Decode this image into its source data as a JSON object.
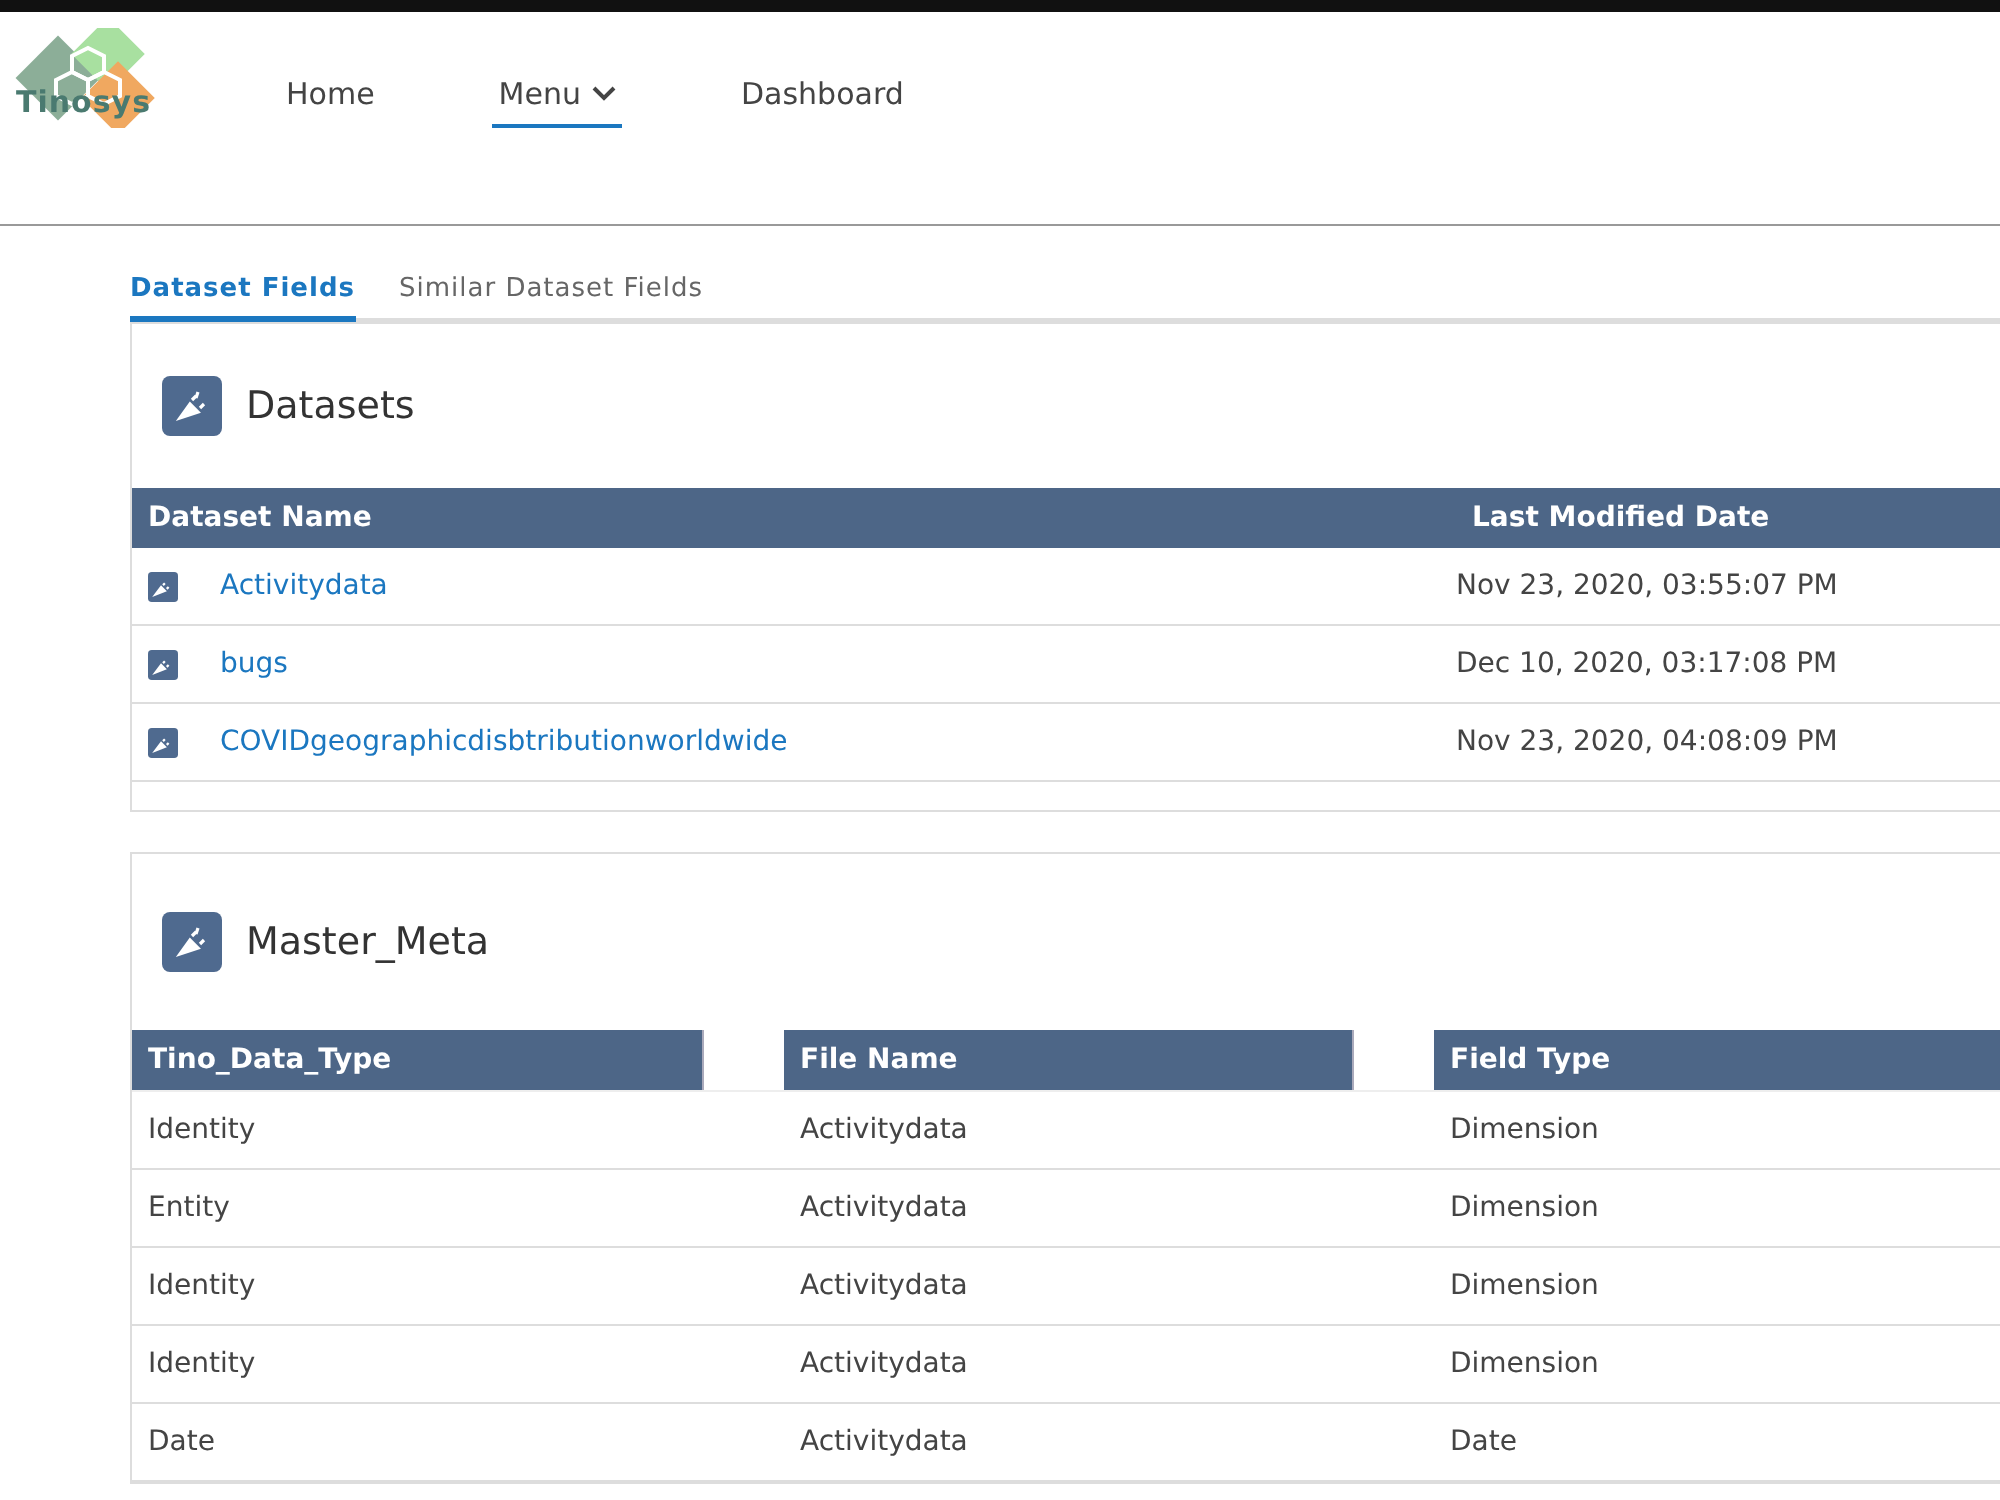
{
  "logo": {
    "text": "Tinosys"
  },
  "nav": [
    {
      "label": "Home",
      "selected": false,
      "kind": "link"
    },
    {
      "label": "Menu",
      "selected": true,
      "kind": "dropdown"
    },
    {
      "label": "Dashboard",
      "selected": false,
      "kind": "link"
    }
  ],
  "tabs": [
    {
      "label": "Dataset Fields",
      "selected": true
    },
    {
      "label": "Similar Dataset Fields",
      "selected": false
    }
  ],
  "datasets": {
    "title": "Datasets",
    "columns": [
      "Dataset Name",
      "Last Modified Date"
    ],
    "rows": [
      {
        "name": "Activitydata",
        "date": "Nov 23, 2020, 03:55:07 PM"
      },
      {
        "name": "bugs",
        "date": "Dec 10, 2020, 03:17:08 PM"
      },
      {
        "name": "COVIDgeographicdisbtributionworldwide",
        "date": "Nov 23, 2020, 04:08:09 PM"
      }
    ]
  },
  "master_meta": {
    "title": "Master_Meta",
    "columns": [
      "Tino_Data_Type",
      "File Name",
      "Field Type"
    ],
    "rows": [
      [
        "Identity",
        "Activitydata",
        "Dimension"
      ],
      [
        "Entity",
        "Activitydata",
        "Dimension"
      ],
      [
        "Identity",
        "Activitydata",
        "Dimension"
      ],
      [
        "Identity",
        "Activitydata",
        "Dimension"
      ],
      [
        "Date",
        "Activitydata",
        "Date"
      ]
    ]
  }
}
